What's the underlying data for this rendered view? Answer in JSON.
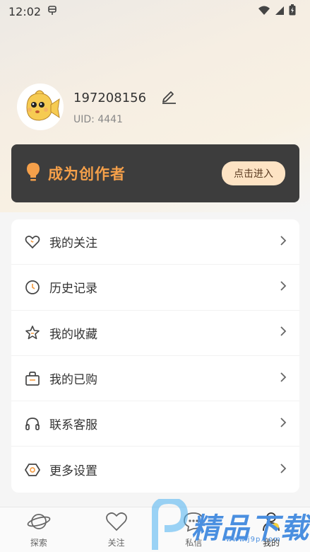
{
  "status_bar": {
    "time": "12:02"
  },
  "profile": {
    "username": "197208156",
    "uid": "UID: 4441"
  },
  "creator": {
    "title": "成为创作者",
    "button": "点击进入"
  },
  "menu": [
    {
      "label": "我的关注",
      "icon": "heart-icon"
    },
    {
      "label": "历史记录",
      "icon": "clock-icon"
    },
    {
      "label": "我的收藏",
      "icon": "star-icon"
    },
    {
      "label": "我的已购",
      "icon": "bag-icon"
    },
    {
      "label": "联系客服",
      "icon": "headset-icon"
    },
    {
      "label": "更多设置",
      "icon": "settings-hex-icon"
    }
  ],
  "tabs": [
    {
      "label": "探索",
      "icon": "planet-icon"
    },
    {
      "label": "关注",
      "icon": "heart-icon"
    },
    {
      "label": "私信",
      "icon": "chat-icon"
    },
    {
      "label": "我的",
      "icon": "user-icon"
    }
  ],
  "watermark": {
    "text": "精品下载",
    "url": "www.j9p.com"
  },
  "colors": {
    "accent": "#f5a04a",
    "banner_bg": "#3d3d3d",
    "button_bg": "#fde3c4"
  }
}
